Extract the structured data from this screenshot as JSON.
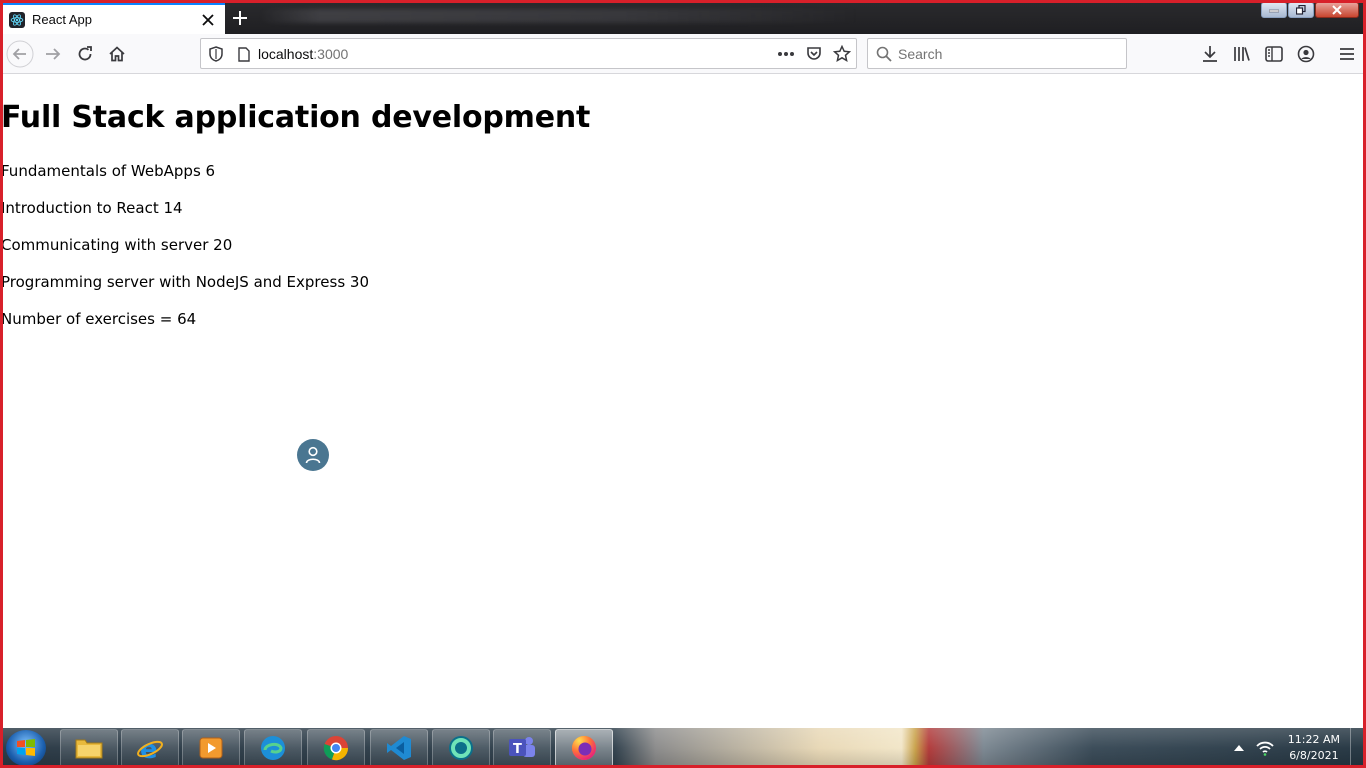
{
  "browser": {
    "tab": {
      "title": "React App",
      "favicon": "react-logo-icon"
    },
    "url": {
      "host": "localhost",
      "port": ":3000"
    },
    "search": {
      "placeholder": "Search"
    }
  },
  "page": {
    "header": "Full Stack application development",
    "parts": [
      {
        "name": "Fundamentals of WebApps",
        "exercises": 6
      },
      {
        "name": "Introduction to React",
        "exercises": 14
      },
      {
        "name": "Communicating with server",
        "exercises": 20
      },
      {
        "name": "Programming server with NodeJS and Express",
        "exercises": 30
      }
    ],
    "lines": [
      "Fundamentals of WebApps 6",
      "Introduction to React 14",
      "Communicating with server 20",
      "Programming server with NodeJS and Express 30"
    ],
    "total_label": "Number of exercises = 64",
    "total_value": 64
  },
  "taskbar": {
    "apps": [
      "file-explorer-icon",
      "internet-explorer-icon",
      "media-player-icon",
      "edge-icon",
      "chrome-icon",
      "vscode-icon",
      "skype-icon",
      "teams-icon",
      "firefox-icon"
    ],
    "clock": {
      "time": "11:22 AM",
      "date": "6/8/2021"
    }
  },
  "colors": {
    "frame": "#d8202a",
    "accent": "#0a84ff",
    "avatar": "#4a7691"
  }
}
